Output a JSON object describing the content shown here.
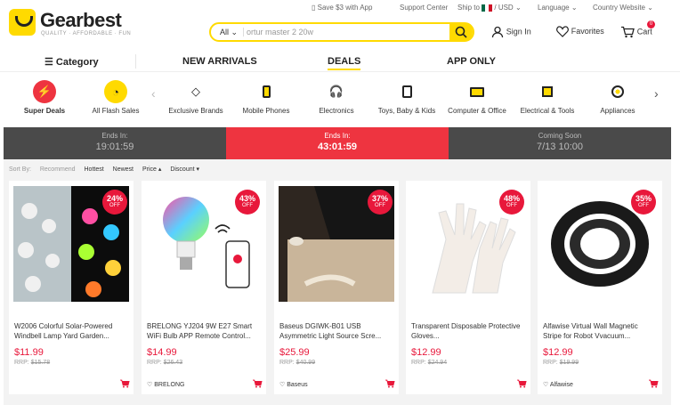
{
  "topbar": {
    "save_text": "Save $3 with App",
    "support": "Support Center",
    "ship_to": "Ship to",
    "currency": "/ USD",
    "language": "Language",
    "country": "Country Website"
  },
  "logo": {
    "name": "Gearbest",
    "tagline": "QUALITY · AFFORDABLE · FUN"
  },
  "search": {
    "category": "All",
    "value": "ortur master 2 20w"
  },
  "user": {
    "signin": "Sign In",
    "favorites": "Favorites",
    "cart": "Cart",
    "cart_count": "0"
  },
  "nav": {
    "category": "Category",
    "new_arrivals": "NEW ARRIVALS",
    "deals": "DEALS",
    "app_only": "APP ONLY"
  },
  "categories": [
    {
      "label": "Super Deals",
      "icon": "lightning-icon",
      "bg": "#ee3440"
    },
    {
      "label": "All Flash Sales",
      "icon": "clock-icon",
      "bg": "#ffda00"
    },
    {
      "label": "Exclusive Brands",
      "icon": "diamond-icon",
      "bg": "#fff"
    },
    {
      "label": "Mobile Phones",
      "icon": "phone-icon",
      "bg": "#fff"
    },
    {
      "label": "Electronics",
      "icon": "headphones-icon",
      "bg": "#fff"
    },
    {
      "label": "Toys, Baby & Kids",
      "icon": "toy-icon",
      "bg": "#fff"
    },
    {
      "label": "Computer & Office",
      "icon": "monitor-icon",
      "bg": "#fff"
    },
    {
      "label": "Electrical & Tools",
      "icon": "chip-icon",
      "bg": "#fff"
    },
    {
      "label": "Appliances",
      "icon": "appliance-icon",
      "bg": "#fff"
    }
  ],
  "timebar": [
    {
      "label": "Ends In:",
      "time": "19:01:59"
    },
    {
      "label": "Ends In:",
      "time": "43:01:59"
    },
    {
      "label": "Coming Soon",
      "time": "7/13  10:00"
    }
  ],
  "sort": {
    "label": "Sort By:",
    "recommend": "Recommend",
    "hottest": "Hottest",
    "newest": "Newest",
    "price": "Price ▴",
    "discount": "Discount ▾"
  },
  "products": [
    {
      "pct": "24%",
      "off": "OFF",
      "name": "W2006 Colorful Solar-Powered Windbell Lamp Yard Garden...",
      "price": "$11.99",
      "rrp_label": "RRP:",
      "rrp": "$15.78",
      "brand": ""
    },
    {
      "pct": "43%",
      "off": "OFF",
      "name": "BRELONG YJ204 9W E27 Smart WiFi Bulb APP Remote Control...",
      "price": "$14.99",
      "rrp_label": "RRP:",
      "rrp": "$26.43",
      "brand": "BRELONG"
    },
    {
      "pct": "37%",
      "off": "OFF",
      "name": "Baseus DGIWK-B01 USB Asymmetric Light Source Scre...",
      "price": "$25.99",
      "rrp_label": "RRP:",
      "rrp": "$40.99",
      "brand": "Baseus"
    },
    {
      "pct": "48%",
      "off": "OFF",
      "name": "Transparent Disposable Protective Gloves...",
      "price": "$12.99",
      "rrp_label": "RRP:",
      "rrp": "$24.94",
      "brand": ""
    },
    {
      "pct": "35%",
      "off": "OFF",
      "name": "Alfawise Virtual Wall Magnetic Stripe for Robot Vvacuum...",
      "price": "$12.99",
      "rrp_label": "RRP:",
      "rrp": "$19.99",
      "brand": "Alfawise"
    }
  ]
}
